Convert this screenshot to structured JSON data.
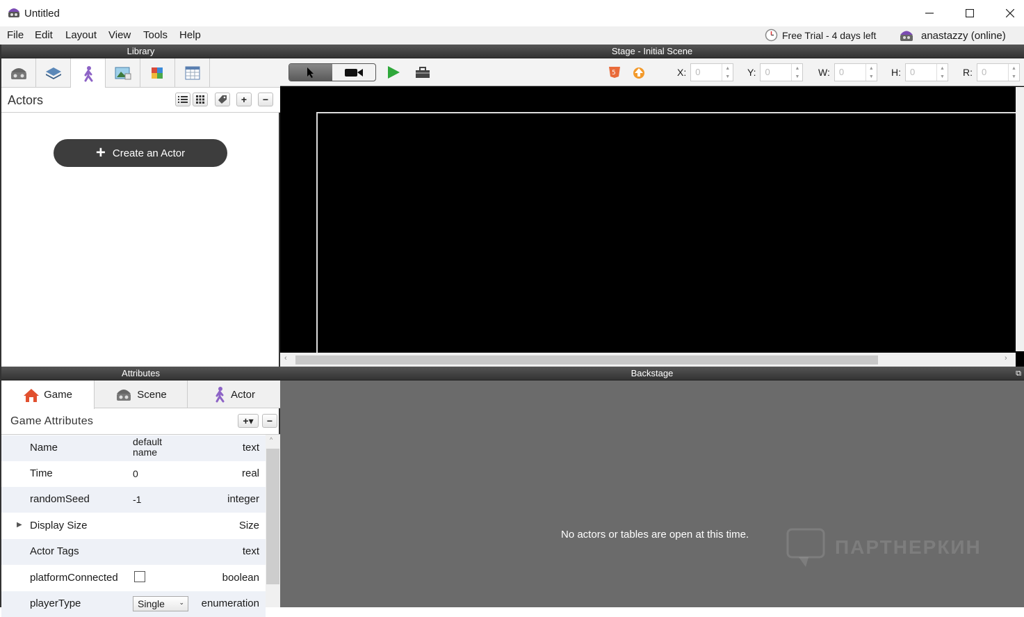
{
  "window": {
    "title": "Untitled"
  },
  "menu": {
    "items": [
      "File",
      "Edit",
      "Layout",
      "View",
      "Tools",
      "Help"
    ],
    "trial": "Free Trial - 4 days left",
    "user": "anastazzy (online)"
  },
  "library": {
    "header": "Library",
    "section_title": "Actors",
    "create_button": "Create an Actor",
    "tab_icons": [
      "scene-tab-icon",
      "layers-tab-icon",
      "actor-tab-icon",
      "image-tab-icon",
      "tileset-tab-icon",
      "table-tab-icon"
    ]
  },
  "stage": {
    "header": "Stage - Initial Scene",
    "fields": [
      {
        "label": "X:",
        "value": "0"
      },
      {
        "label": "Y:",
        "value": "0"
      },
      {
        "label": "W:",
        "value": "0"
      },
      {
        "label": "H:",
        "value": "0"
      },
      {
        "label": "R:",
        "value": "0"
      }
    ]
  },
  "attributes": {
    "header": "Attributes",
    "tabs": [
      "Game",
      "Scene",
      "Actor"
    ],
    "section_title": "Game Attributes",
    "rows": [
      {
        "name": "Name",
        "value": "default name",
        "type": "text"
      },
      {
        "name": "Time",
        "value": "0",
        "type": "real"
      },
      {
        "name": "randomSeed",
        "value": "-1",
        "type": "integer"
      },
      {
        "name": "Display Size",
        "value": "",
        "type": "Size"
      },
      {
        "name": "Actor Tags",
        "value": "",
        "type": "text"
      },
      {
        "name": "platformConnected",
        "value": "",
        "type": "boolean"
      },
      {
        "name": "playerType",
        "value": "Single",
        "type": "enumeration"
      }
    ]
  },
  "backstage": {
    "header": "Backstage",
    "message": "No actors or tables are open at this time.",
    "watermark": "ПАРТНЕРКИН"
  }
}
